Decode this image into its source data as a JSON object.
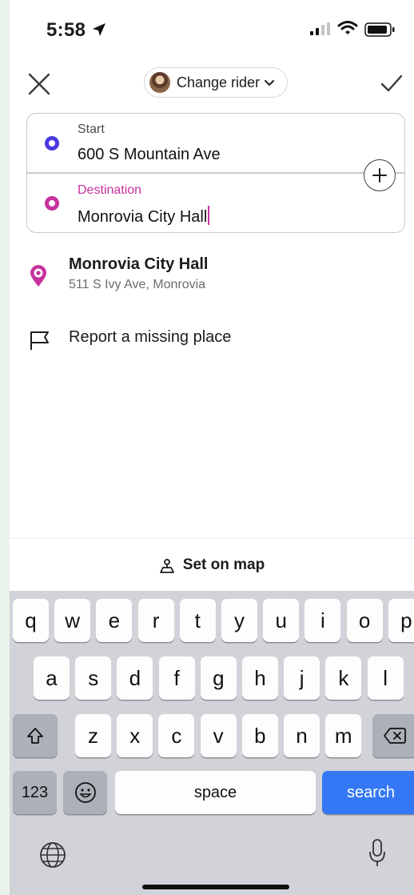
{
  "status_bar": {
    "time": "5:58"
  },
  "header": {
    "rider_label": "Change rider"
  },
  "route": {
    "start_label": "Start",
    "start_value": "600 S Mountain Ave",
    "destination_label": "Destination",
    "destination_value": "Monrovia City Hall"
  },
  "results": [
    {
      "title": "Monrovia City Hall",
      "subtitle": "511 S Ivy Ave, Monrovia"
    }
  ],
  "report_label": "Report a missing place",
  "map_bar": {
    "label": "Set on map"
  },
  "keyboard": {
    "row1": [
      "q",
      "w",
      "e",
      "r",
      "t",
      "y",
      "u",
      "i",
      "o",
      "p"
    ],
    "row2": [
      "a",
      "s",
      "d",
      "f",
      "g",
      "h",
      "j",
      "k",
      "l"
    ],
    "row3": [
      "z",
      "x",
      "c",
      "v",
      "b",
      "n",
      "m"
    ],
    "numbers_label": "123",
    "space_label": "space",
    "search_label": "search"
  },
  "icons": [
    "location-arrow-icon",
    "signal-icon",
    "wifi-icon",
    "battery-icon",
    "close-icon",
    "check-icon",
    "chevron-down-icon",
    "plus-icon",
    "pin-icon",
    "flag-icon",
    "map-pin-icon",
    "shift-icon",
    "delete-icon",
    "emoji-icon",
    "globe-icon",
    "mic-icon"
  ],
  "colors": {
    "start_accent": "#4a3be0",
    "destination_accent": "#c7329c",
    "search_key": "#3478f6",
    "keyboard_bg": "#d1d3d9"
  }
}
